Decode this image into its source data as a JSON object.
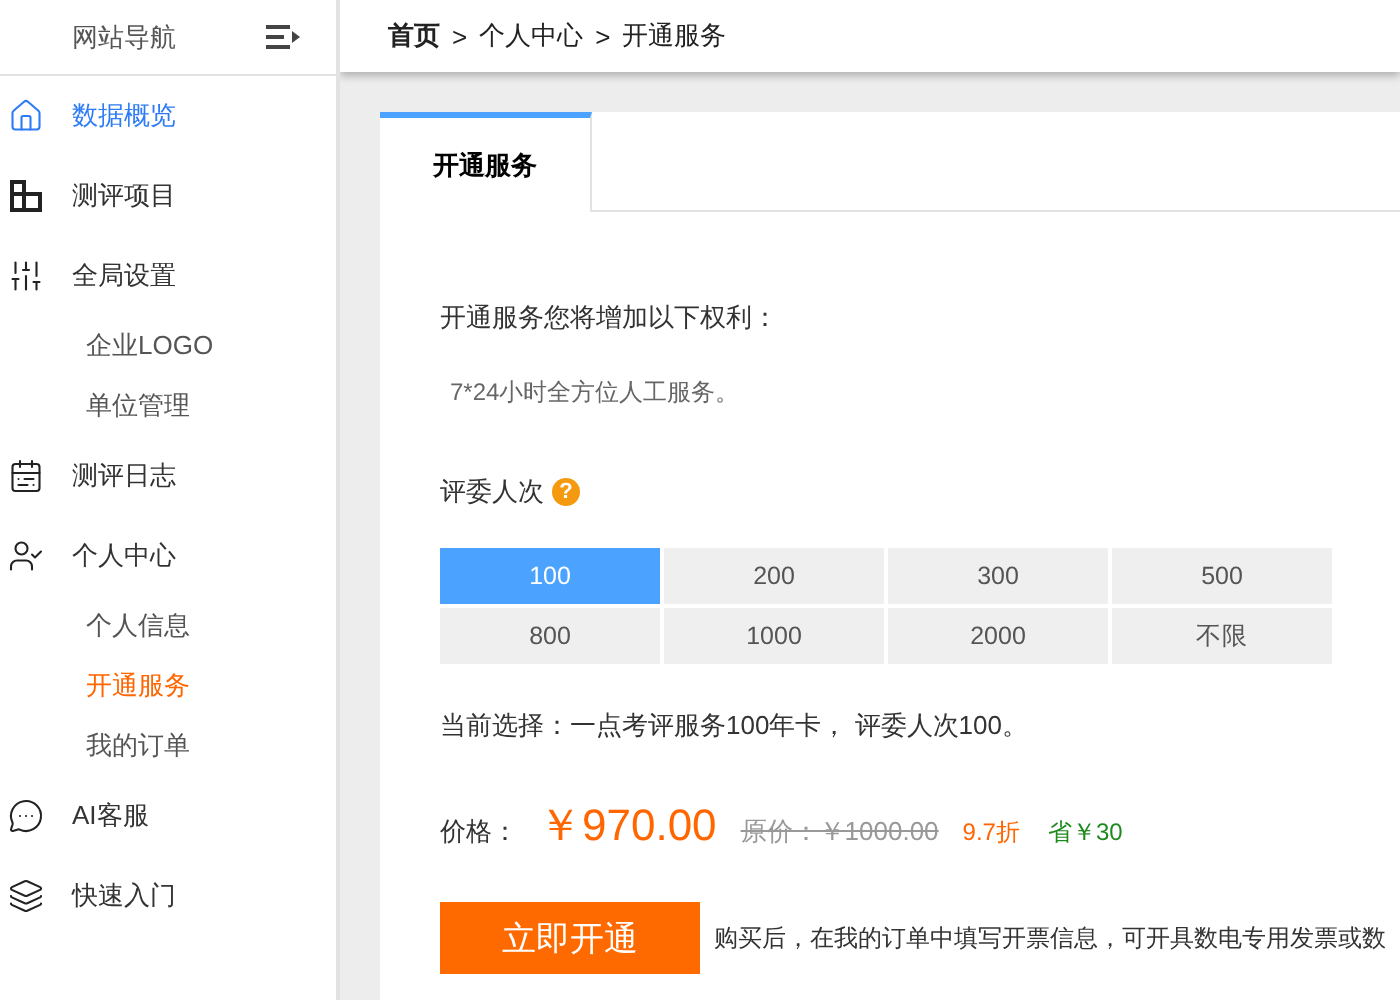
{
  "sidebar": {
    "title": "网站导航",
    "items": [
      {
        "label": "数据概览",
        "selected": true
      },
      {
        "label": "测评项目",
        "selected": false
      },
      {
        "label": "全局设置",
        "selected": false,
        "children": [
          {
            "label": "企业LOGO",
            "selected": false
          },
          {
            "label": "单位管理",
            "selected": false
          }
        ]
      },
      {
        "label": "测评日志",
        "selected": false
      },
      {
        "label": "个人中心",
        "selected": false,
        "children": [
          {
            "label": "个人信息",
            "selected": false
          },
          {
            "label": "开通服务",
            "selected": true
          },
          {
            "label": "我的订单",
            "selected": false
          }
        ]
      },
      {
        "label": "AI客服",
        "selected": false
      },
      {
        "label": "快速入门",
        "selected": false
      }
    ]
  },
  "breadcrumb": [
    {
      "label": "首页",
      "kind": "home"
    },
    {
      "label": "个人中心",
      "kind": "link"
    },
    {
      "label": "开通服务",
      "kind": "current"
    }
  ],
  "breadcrumb_separator": ">",
  "tabs": [
    {
      "label": "开通服务",
      "selected": true
    }
  ],
  "benefits": {
    "title": "开通服务您将增加以下权利：",
    "items": [
      "7*24小时全方位人工服务。"
    ]
  },
  "reviewers": {
    "label": "评委人次",
    "help": "?",
    "options": [
      {
        "label": "100",
        "selected": true
      },
      {
        "label": "200",
        "selected": false
      },
      {
        "label": "300",
        "selected": false
      },
      {
        "label": "500",
        "selected": false
      },
      {
        "label": "800",
        "selected": false
      },
      {
        "label": "1000",
        "selected": false
      },
      {
        "label": "2000",
        "selected": false
      },
      {
        "label": "不限",
        "selected": false
      }
    ]
  },
  "current_selection": "当前选择：一点考评服务100年卡， 评委人次100。",
  "price": {
    "label": "价格：",
    "value": "￥970.00",
    "original": "原价：￥1000.00",
    "discount": "9.7折",
    "saving": "省￥30"
  },
  "buy_button": "立即开通",
  "invoice_note": "购买后，在我的订单中填写开票信息，可开具数电专用发票或数"
}
